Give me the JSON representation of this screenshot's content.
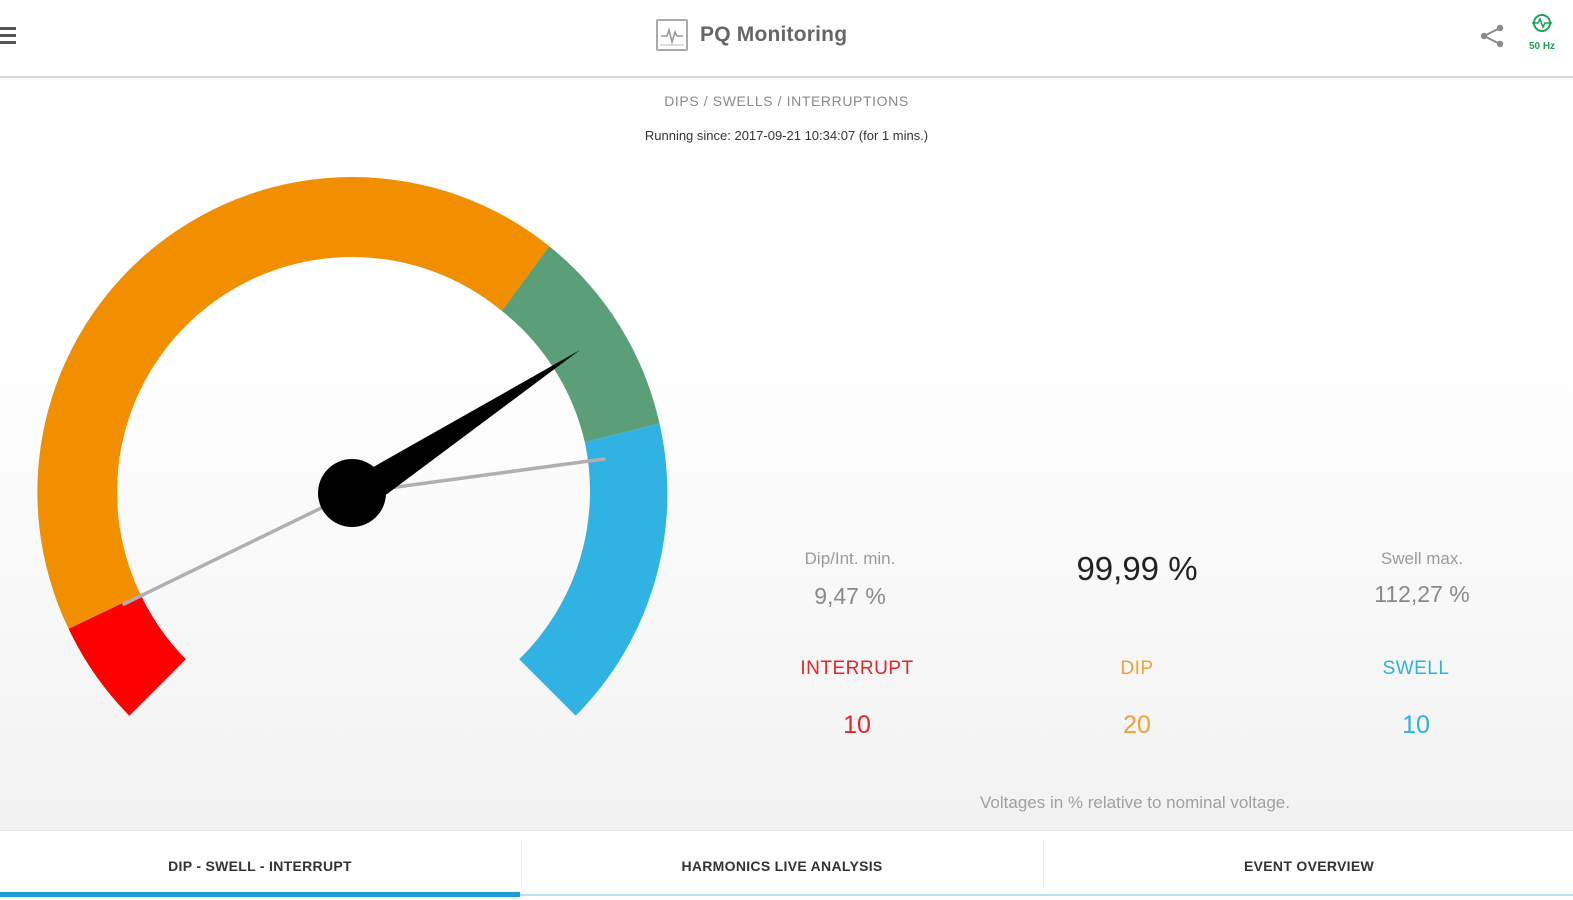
{
  "header": {
    "title": "PQ Monitoring",
    "frequency": "50 Hz",
    "icons": {
      "menu": "hamburger-menu-icon",
      "logo": "waveform-logo-icon",
      "share": "share-icon",
      "frequency": "frequency-signal-icon"
    }
  },
  "section": {
    "heading": "DIPS / SWELLS / INTERRUPTIONS",
    "running_since": "Running since: 2017-09-21 10:34:07 (for 1 mins.)"
  },
  "gauge": {
    "current_value_percent": 99.99,
    "dip_int_min_percent": 9.47,
    "swell_max_percent": 112.27,
    "zones": [
      {
        "name": "interrupt",
        "color": "#ff0000"
      },
      {
        "name": "dip",
        "color": "#f18f00"
      },
      {
        "name": "normal",
        "color": "#5a9f78"
      },
      {
        "name": "swell",
        "color": "#30b2e3"
      }
    ]
  },
  "stats": {
    "dip_int_min": {
      "caption": "Dip/Int. min.",
      "value": "9,47 %"
    },
    "current": {
      "value": "99,99 %"
    },
    "swell_max": {
      "caption": "Swell max.",
      "value": "112,27 %"
    }
  },
  "counters": {
    "interrupt": {
      "label": "INTERRUPT",
      "count": "10",
      "color": "#e32626"
    },
    "dip": {
      "label": "DIP",
      "count": "20",
      "color": "#f0a23a"
    },
    "swell": {
      "label": "SWELL",
      "count": "10",
      "color": "#2fb1e0"
    }
  },
  "footnote": "Voltages in % relative to nominal voltage.",
  "tabs": [
    {
      "label": "DIP - SWELL - INTERRUPT",
      "active": true
    },
    {
      "label": "HARMONICS LIVE ANALYSIS",
      "active": false
    },
    {
      "label": "EVENT OVERVIEW",
      "active": false
    }
  ],
  "colors": {
    "accent": "#1e9ad6",
    "needle": "#000000",
    "minmax_line": "#b0b0b0"
  }
}
